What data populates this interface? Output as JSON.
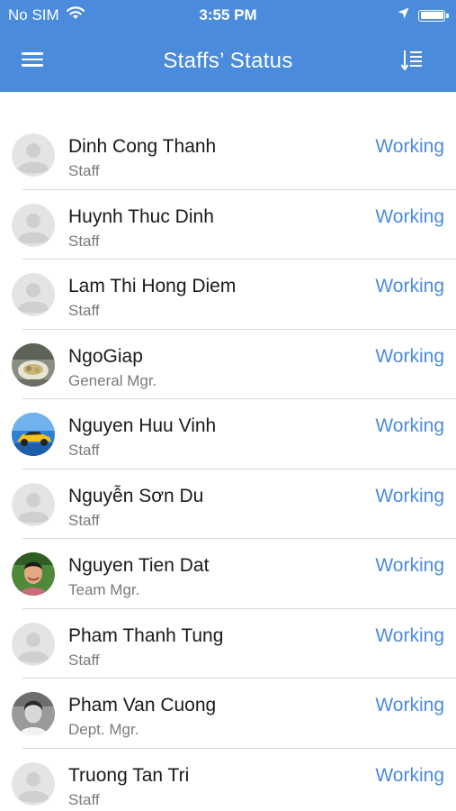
{
  "status_bar": {
    "carrier": "No SIM",
    "time": "3:55 PM",
    "icons": [
      "wifi-icon",
      "location-arrow-icon",
      "battery-icon"
    ]
  },
  "nav": {
    "title": "Staffs’ Status",
    "left_icon": "hamburger-menu-icon",
    "right_icon": "sort-list-icon"
  },
  "colors": {
    "primary": "#4a8bdc",
    "status_text": "#4a8bdc",
    "name_text": "#1a1a1a",
    "role_text": "#7a7a7a",
    "divider": "#d9d9d9"
  },
  "staff": [
    {
      "name": "Dinh Cong Thanh",
      "role": "Staff",
      "status": "Working",
      "avatar": "placeholder"
    },
    {
      "name": "Huynh Thuc Dinh",
      "role": "Staff",
      "status": "Working",
      "avatar": "placeholder"
    },
    {
      "name": "Lam Thi Hong Diem",
      "role": "Staff",
      "status": "Working",
      "avatar": "placeholder"
    },
    {
      "name": "NgoGiap",
      "role": "General Mgr.",
      "status": "Working",
      "avatar": "photo-food"
    },
    {
      "name": "Nguyen Huu Vinh",
      "role": "Staff",
      "status": "Working",
      "avatar": "photo-car"
    },
    {
      "name": "Nguyễn Sơn Du",
      "role": "Staff",
      "status": "Working",
      "avatar": "placeholder"
    },
    {
      "name": "Nguyen Tien Dat",
      "role": "Team Mgr.",
      "status": "Working",
      "avatar": "photo-person"
    },
    {
      "name": "Pham Thanh Tung",
      "role": "Staff",
      "status": "Working",
      "avatar": "placeholder"
    },
    {
      "name": "Pham Van Cuong",
      "role": "Dept. Mgr.",
      "status": "Working",
      "avatar": "photo-person-bw"
    },
    {
      "name": "Truong Tan Tri",
      "role": "Staff",
      "status": "Working",
      "avatar": "placeholder"
    }
  ]
}
